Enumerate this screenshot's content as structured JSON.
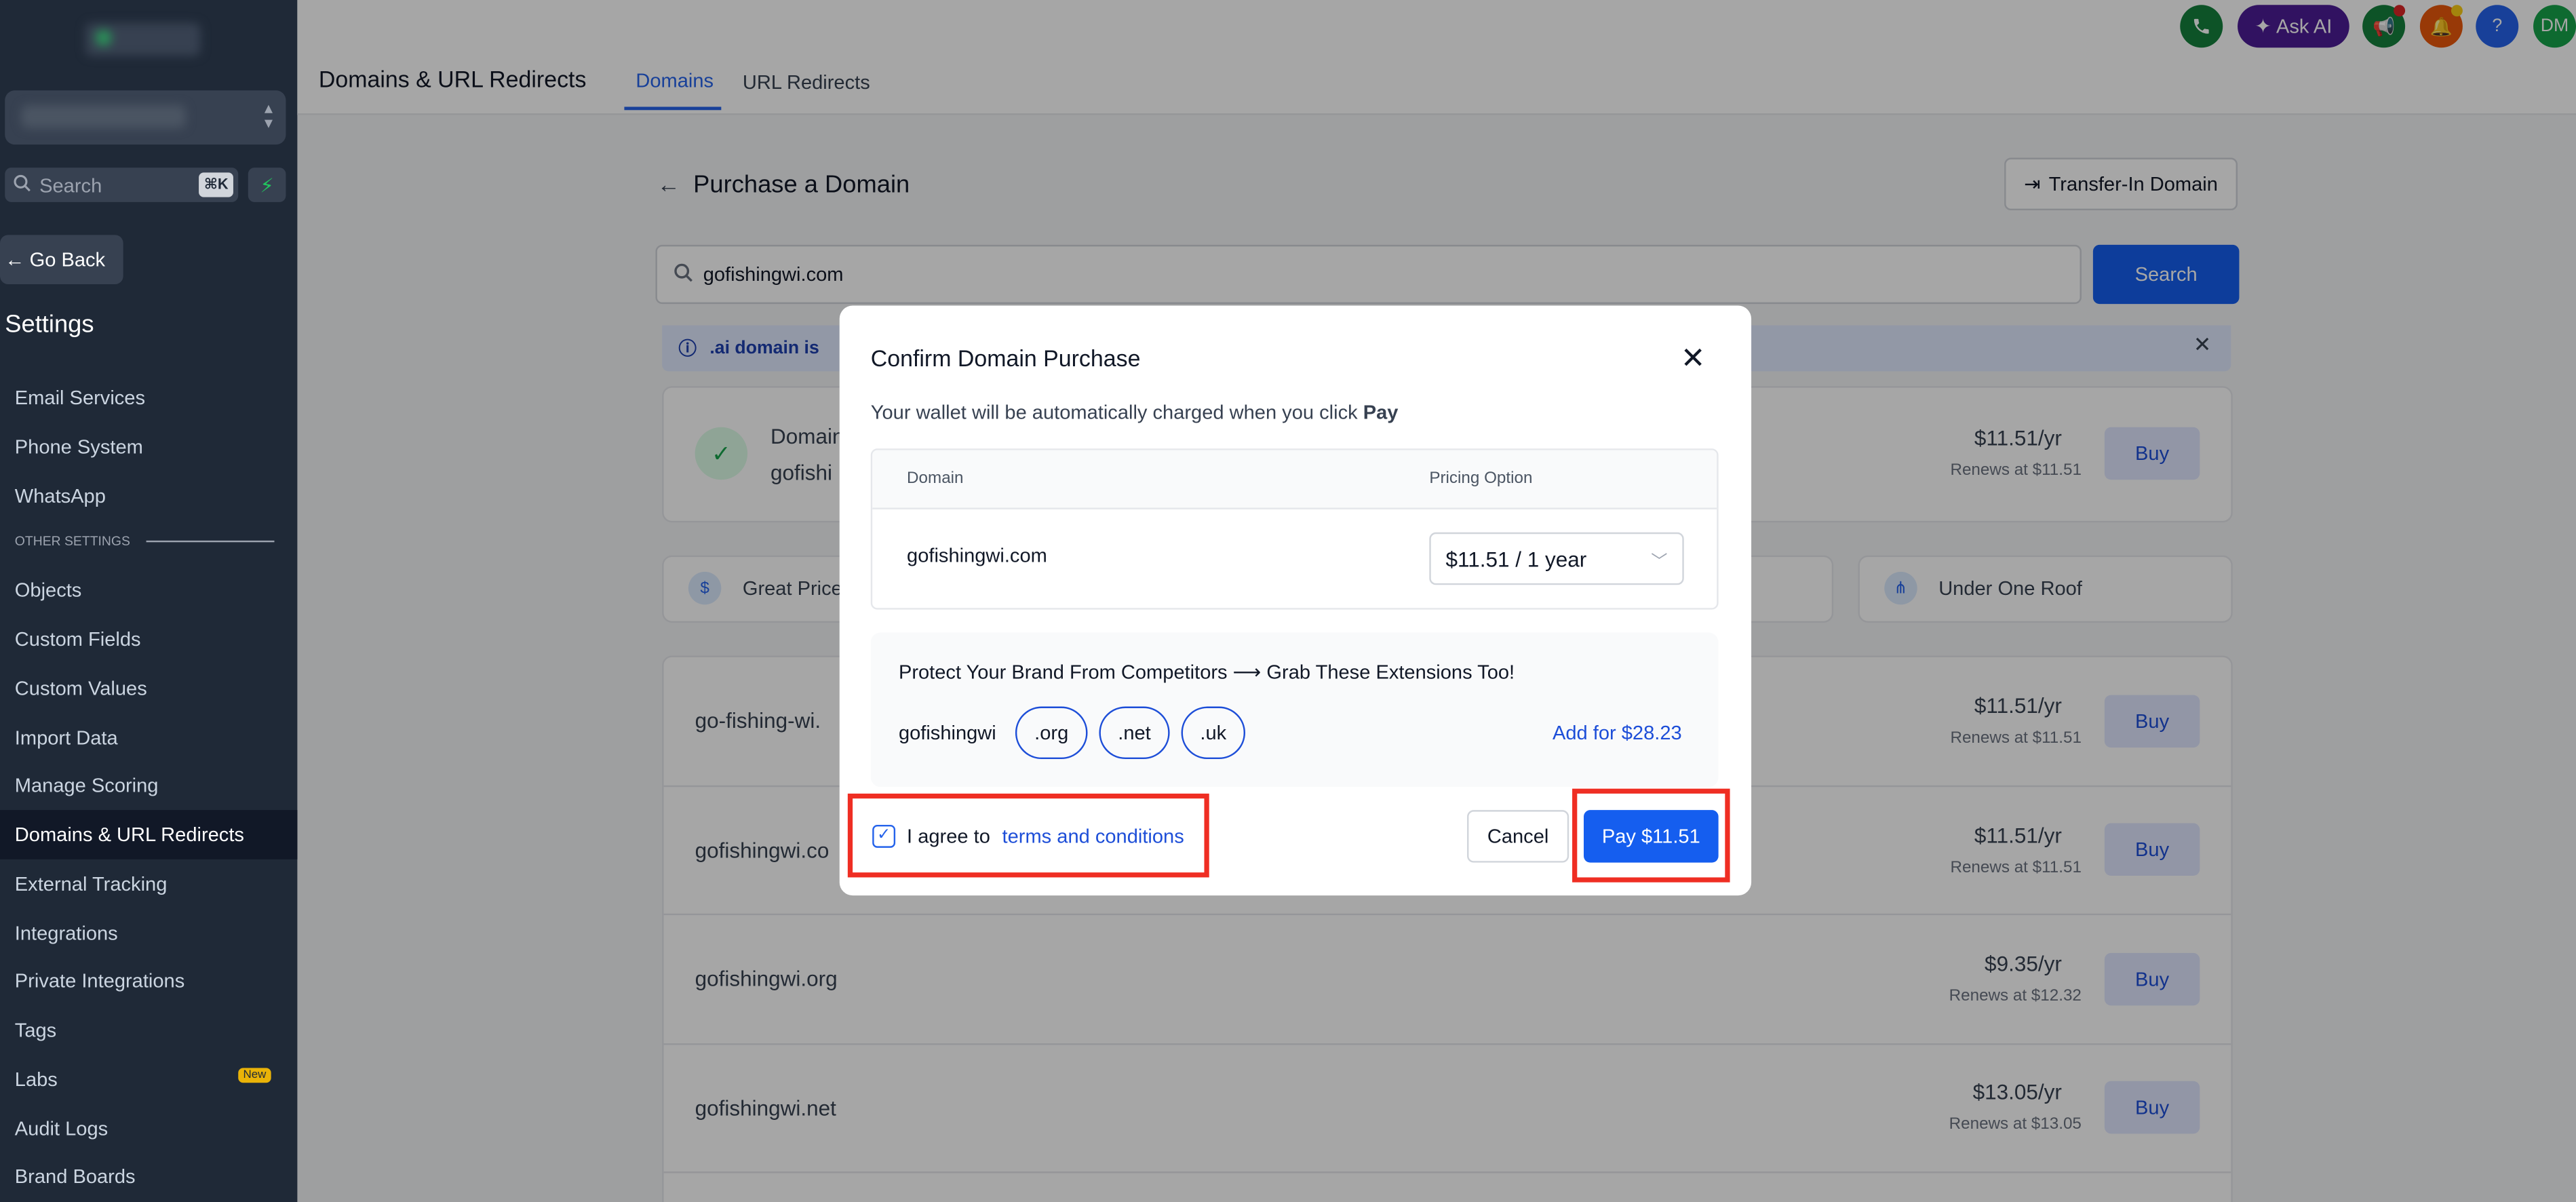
{
  "sidebar": {
    "search_placeholder": "Search",
    "search_shortcut": "⌘K",
    "go_back": "Go Back",
    "heading": "Settings",
    "items_top": [
      "Email Services",
      "Phone System",
      "WhatsApp"
    ],
    "section_label": "OTHER SETTINGS",
    "items": [
      "Objects",
      "Custom Fields",
      "Custom Values",
      "Import Data",
      "Manage Scoring",
      "Domains & URL Redirects",
      "External Tracking",
      "Integrations",
      "Private Integrations",
      "Tags",
      "Labs",
      "Audit Logs",
      "Brand Boards"
    ],
    "active_item": "Domains & URL Redirects",
    "labs_badge": "New"
  },
  "header": {
    "title": "Domains & URL Redirects",
    "tabs": [
      "Domains",
      "URL Redirects"
    ],
    "ask_ai": "Ask AI",
    "avatar_initials": "DM",
    "help": "?"
  },
  "main": {
    "title": "Purchase a Domain",
    "transfer_button": "Transfer-In Domain",
    "search_value": "gofishingwi.com",
    "search_button": "Search",
    "info_text": ".ai domain is",
    "primary_result": {
      "line1": "Domain",
      "line2": "gofishi",
      "price": "$11.51/yr",
      "renews": "Renews at $11.51",
      "buy": "Buy"
    },
    "features": [
      "Great Price",
      "Under One Roof"
    ],
    "results": [
      {
        "domain": "go-fishing-wi.",
        "price": "$11.51/yr",
        "renews": "Renews at $11.51",
        "buy": "Buy"
      },
      {
        "domain": "gofishingwi.co",
        "price": "$11.51/yr",
        "renews": "Renews at $11.51",
        "buy": "Buy"
      },
      {
        "domain": "gofishingwi.org",
        "price": "$9.35/yr",
        "renews": "Renews at $12.32",
        "buy": "Buy"
      },
      {
        "domain": "gofishingwi.net",
        "price": "$13.05/yr",
        "renews": "Renews at $13.05",
        "buy": "Buy"
      }
    ]
  },
  "modal": {
    "title": "Confirm Domain Purchase",
    "subtitle_prefix": "Your wallet will be automatically charged when you click",
    "subtitle_bold": "Pay",
    "col_domain": "Domain",
    "col_pricing": "Pricing Option",
    "domain": "gofishingwi.com",
    "pricing_selected": "$11.51 / 1 year",
    "protect_text": "Protect Your Brand From Competitors ⟶ Grab These Extensions Too!",
    "protect_name": "gofishingwi",
    "extensions": [
      ".org",
      ".net",
      ".uk"
    ],
    "add_link": "Add for $28.23",
    "agree_text": "I agree to",
    "terms_link": "terms and conditions",
    "cancel": "Cancel",
    "pay": "Pay $11.51",
    "checkbox_checked": true
  },
  "colors": {
    "primary": "#155eef",
    "sidebar_bg": "#1f2937",
    "highlight": "#ef2e23"
  }
}
